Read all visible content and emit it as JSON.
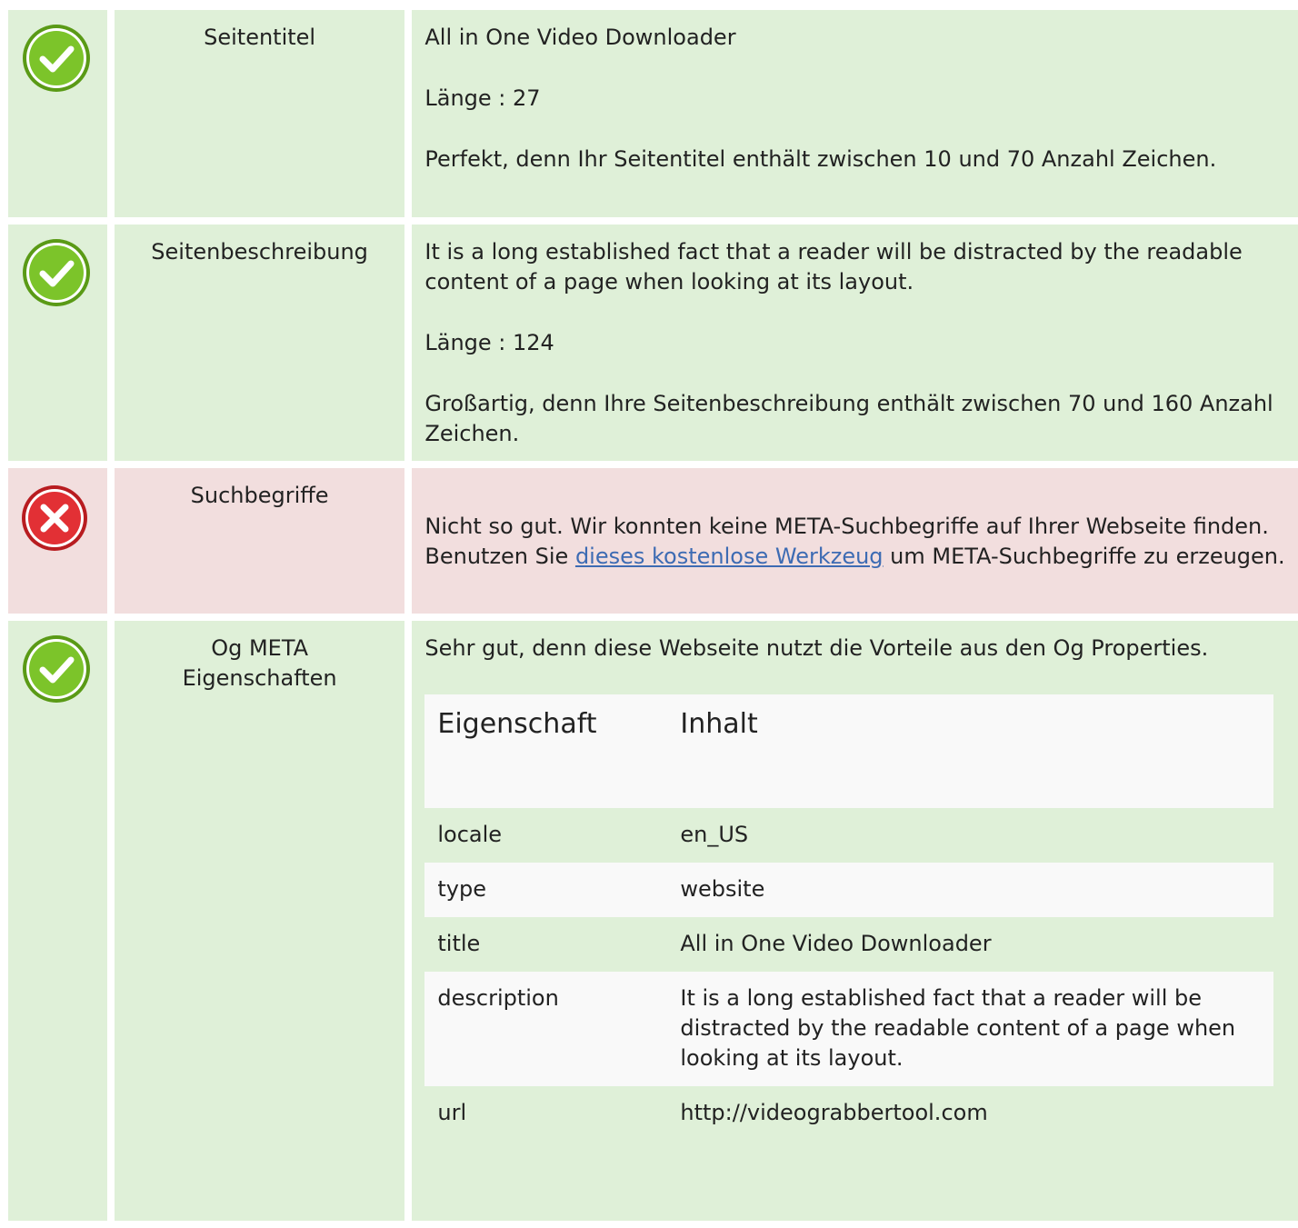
{
  "rows": [
    {
      "status": "ok",
      "label": "Seitentitel",
      "paragraphs": [
        "All in One Video Downloader",
        "Länge : 27",
        "Perfekt, denn Ihr Seitentitel enthält zwischen 10 und 70 Anzahl Zeichen."
      ]
    },
    {
      "status": "ok",
      "label": "Seitenbeschreibung",
      "paragraphs": [
        "It is a long established fact that a reader will be distracted by the readable content of a page when looking at its layout.",
        "Länge : 124",
        "Großartig, denn Ihre Seitenbeschreibung enthält zwischen 70 und 160 Anzahl Zeichen."
      ]
    },
    {
      "status": "bad",
      "label": "Suchbegriffe",
      "text_before_link": "Nicht so gut. Wir konnten keine META-Suchbegriffe auf Ihrer Webseite finden. Benutzen Sie ",
      "link_text": "dieses kostenlose Werkzeug",
      "text_after_link": " um META-Suchbegriffe zu erzeugen."
    },
    {
      "status": "ok",
      "label_line1": "Og META",
      "label_line2": "Eigenschaften",
      "intro": "Sehr gut, denn diese Webseite nutzt die Vorteile aus den Og Properties.",
      "table": {
        "headers": [
          "Eigenschaft",
          "Inhalt"
        ],
        "rows": [
          [
            "locale",
            "en_US"
          ],
          [
            "type",
            "website"
          ],
          [
            "title",
            "All in One Video Downloader"
          ],
          [
            "description",
            "It is a long established fact that a reader will be distracted by the readable content of a page when looking at its layout."
          ],
          [
            "url",
            "http://videograbbertool.com"
          ]
        ]
      }
    }
  ],
  "colors": {
    "ok_bg": "#dff0d8",
    "bad_bg": "#f2dede",
    "ok_icon": "#6cb71f",
    "bad_icon": "#e0262b",
    "link": "#3d6bb3"
  }
}
